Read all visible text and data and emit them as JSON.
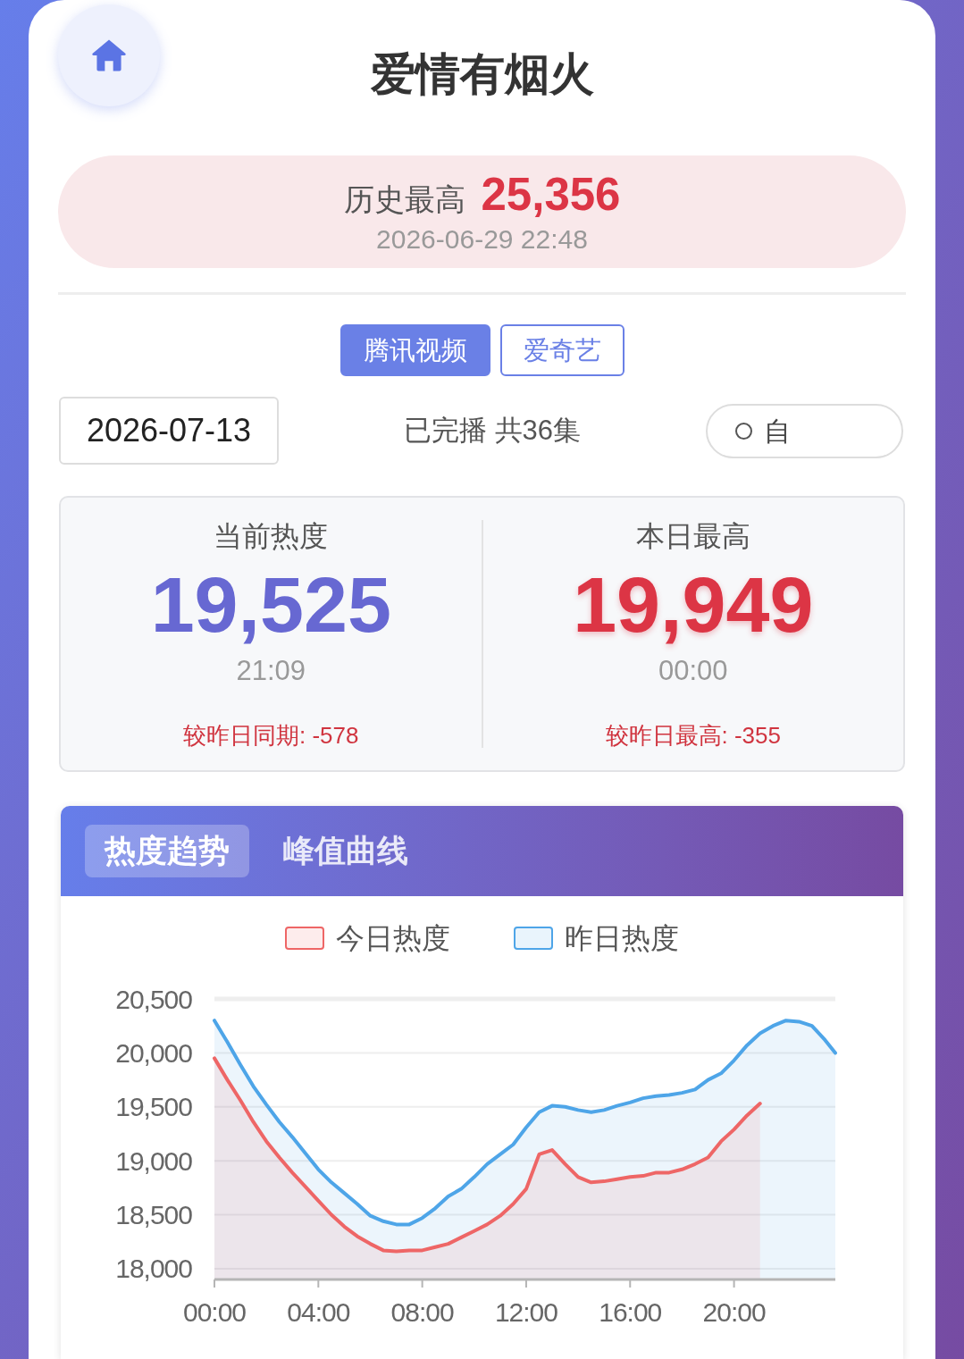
{
  "title": "爱情有烟火",
  "history_high": {
    "label": "历史最高",
    "value": "25,356",
    "time": "2026-06-29 22:48"
  },
  "platform_tabs": [
    {
      "label": "腾讯视频",
      "selected": true
    },
    {
      "label": "爱奇艺",
      "selected": false
    }
  ],
  "date_field": {
    "value": "2026-07-13"
  },
  "status": "已完播 共36集",
  "toggle": {
    "label": "自",
    "checked": false
  },
  "stats": [
    {
      "kind": "current",
      "label": "当前热度",
      "value": "19,525",
      "time": "21:09",
      "compare": "较昨日同期: -578"
    },
    {
      "kind": "peak",
      "label": "本日最高",
      "value": "19,949",
      "time": "00:00",
      "compare": "较昨日最高: -355"
    }
  ],
  "chart_panel": {
    "tabs": [
      {
        "label": "热度趋势",
        "selected": true
      },
      {
        "label": "峰值曲线",
        "selected": false
      }
    ],
    "chart_data": {
      "type": "area",
      "grid": true,
      "x": [
        0,
        0.5,
        1,
        1.5,
        2,
        2.5,
        3,
        3.5,
        4,
        4.5,
        5,
        5.5,
        6,
        6.5,
        7,
        7.5,
        8,
        8.5,
        9,
        9.5,
        10,
        10.5,
        11,
        11.5,
        12,
        12.5,
        13,
        13.5,
        14,
        14.5,
        15,
        15.5,
        16,
        16.5,
        17,
        17.5,
        18,
        18.5,
        19,
        19.5,
        20,
        20.5,
        21,
        21.5,
        22,
        22.5,
        23,
        23.5,
        23.9
      ],
      "series": [
        {
          "name": "今日热度",
          "color": "#ee6666",
          "values": [
            19950,
            19750,
            19560,
            19360,
            19180,
            19030,
            18890,
            18760,
            18630,
            18500,
            18390,
            18300,
            18230,
            18170,
            18160,
            18170,
            18170,
            18200,
            18230,
            18290,
            18350,
            18410,
            18490,
            18600,
            18740,
            19060,
            19100,
            18970,
            18850,
            18800,
            18810,
            18830,
            18850,
            18860,
            18890,
            18890,
            18920,
            18970,
            19030,
            19180,
            19290,
            19420,
            19530,
            null,
            null,
            null,
            null,
            null,
            null
          ]
        },
        {
          "name": "昨日热度",
          "color": "#4ea5e8",
          "values": [
            20300,
            20100,
            19890,
            19690,
            19520,
            19360,
            19220,
            19070,
            18920,
            18800,
            18700,
            18600,
            18490,
            18440,
            18410,
            18410,
            18470,
            18560,
            18670,
            18740,
            18850,
            18970,
            19060,
            19150,
            19310,
            19450,
            19510,
            19500,
            19470,
            19450,
            19470,
            19510,
            19540,
            19580,
            19600,
            19610,
            19630,
            19660,
            19750,
            19810,
            19930,
            20070,
            20180,
            20250,
            20300,
            20290,
            20250,
            20120,
            20000
          ]
        }
      ],
      "xlim": [
        0,
        23.9
      ],
      "ylim": [
        17900,
        20500
      ],
      "xticks": [
        {
          "value": 0,
          "label": "00:00"
        },
        {
          "value": 4,
          "label": "04:00"
        },
        {
          "value": 8,
          "label": "08:00"
        },
        {
          "value": 12,
          "label": "12:00"
        },
        {
          "value": 16,
          "label": "16:00"
        },
        {
          "value": 20,
          "label": "20:00"
        }
      ],
      "yticks": [
        {
          "value": 18000,
          "label": "18,000"
        },
        {
          "value": 18500,
          "label": "18,500"
        },
        {
          "value": 19000,
          "label": "19,000"
        },
        {
          "value": 19500,
          "label": "19,500"
        },
        {
          "value": 20000,
          "label": "20,000"
        },
        {
          "value": 20500,
          "label": "20,500"
        }
      ]
    }
  }
}
